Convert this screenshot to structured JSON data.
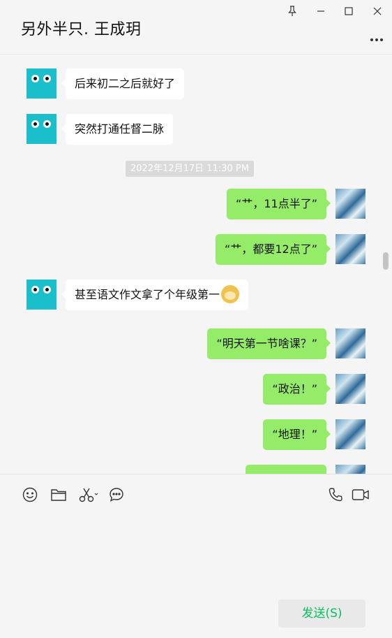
{
  "header": {
    "title": "另外半只. 王成玥"
  },
  "window_controls": [
    "pin-icon",
    "minimize-icon",
    "maximize-icon",
    "close-icon"
  ],
  "messages": [
    {
      "side": "left",
      "text": "后来初二之后就好了"
    },
    {
      "side": "left",
      "text": "突然打通任督二脉"
    },
    {
      "type": "timestamp",
      "text": "2022年12月17日 11:30 PM"
    },
    {
      "side": "right",
      "text": "“艹，11点半了”"
    },
    {
      "side": "right",
      "text": "“艹，都要12点了”"
    },
    {
      "side": "left",
      "text": "甚至语文作文拿了个年级第一",
      "emoji": "doge-emoji"
    },
    {
      "side": "right",
      "text": "“明天第一节啥课？”"
    },
    {
      "side": "right",
      "text": "“政治！”"
    },
    {
      "side": "right",
      "text": "“地理！”"
    }
  ],
  "toolbar": {
    "icons": [
      "emoji-icon",
      "folder-icon",
      "scissors-icon",
      "chat-history-icon",
      "phone-icon",
      "video-icon"
    ]
  },
  "input": {
    "value": ""
  },
  "send_button": {
    "label": "发送(S)"
  },
  "colors": {
    "self_bubble": "#95ec69",
    "friend_bubble": "#ffffff",
    "friend_avatar": "#1bbfcc",
    "send_text": "#07c160",
    "background": "#f5f5f5"
  }
}
